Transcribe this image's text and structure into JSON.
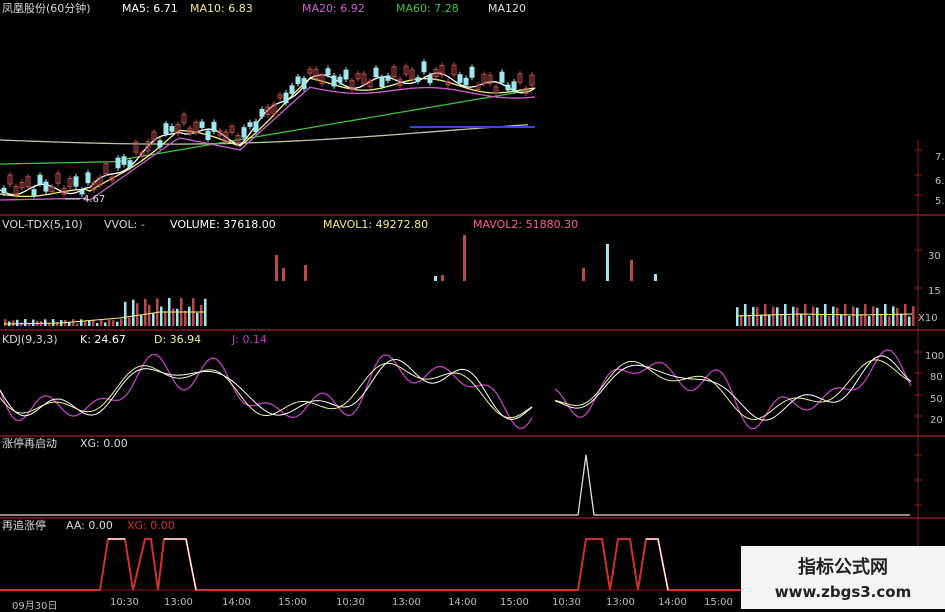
{
  "colors": {
    "panel_border": "#8b1a1a",
    "up": "#b84a4a",
    "down": "#9fe8ee",
    "ma5": "#ffffff",
    "ma10": "#f0f080",
    "ma20": "#d060d0",
    "ma60": "#40c040",
    "ma120": "#4040e0",
    "mavol2": "#ff6090",
    "j_line": "#c040c0",
    "k_line": "#ffffff",
    "d_line": "#f0f0a0",
    "xg_line": "#dddddd",
    "aa_line": "#d03030"
  },
  "price_panel": {
    "title": "凤凰股份(60分钟)",
    "ma5": "MA5: 6.71",
    "ma10": "MA10: 6.83",
    "ma20": "MA20: 6.92",
    "ma60": "MA60: 7.28",
    "ma120": "MA120",
    "low_label": "4.67",
    "ticks": [
      "7.",
      "7.",
      "6.",
      "6.",
      "5."
    ]
  },
  "vol_panel": {
    "name": "VOL-TDX(5,10)",
    "vvol": "VVOL: -",
    "volume": "VOLUME: 37618.00",
    "mavol1": "MAVOL1: 49272.80",
    "mavol2": "MAVOL2: 51880.30",
    "ticks": [
      "30",
      "15",
      "X10"
    ]
  },
  "kdj_panel": {
    "name": "KDJ(9,3,3)",
    "k": "K: 24.67",
    "d": "D: 36.94",
    "j": "J: 0.14",
    "ticks": [
      "100",
      "80",
      "50",
      "20"
    ]
  },
  "xg_panel": {
    "name": "涨停再启动",
    "xg": "XG: 0.00"
  },
  "aa_panel": {
    "name": "再追涨停",
    "aa": "AA: 0.00",
    "xg": "XG: 0.00"
  },
  "time_axis": [
    "09月30日",
    "10:30",
    "13:00",
    "14:00",
    "15:00",
    "10:30",
    "13:00",
    "14:00",
    "15:00",
    "10:30",
    "13:00",
    "14:00",
    "15:00"
  ],
  "watermark": {
    "line1": "指标公式网",
    "line2": "www.zbgs3.com"
  }
}
